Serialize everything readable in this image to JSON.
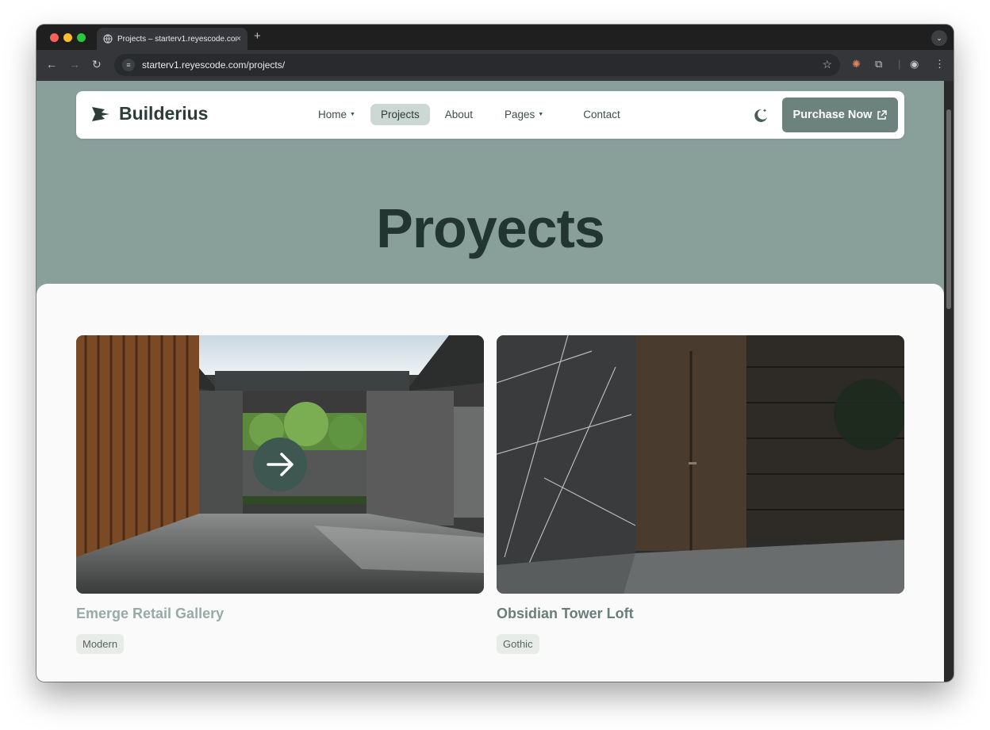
{
  "browser": {
    "tab_title": "Projects – starterv1.reyescode.com",
    "tab_close": "×",
    "new_tab": "+",
    "url": "starterv1.reyescode.com/projects/"
  },
  "site": {
    "brand": "Builderius",
    "nav": [
      {
        "label": "Home",
        "dropdown": true
      },
      {
        "label": "Projects",
        "active": true
      },
      {
        "label": "About"
      },
      {
        "label": "Pages",
        "dropdown": true
      },
      {
        "label": "Contact"
      }
    ],
    "theme_toggle_icon": "moon-stars-icon",
    "purchase_label": "Purchase Now",
    "purchase_icon": "external-link-icon"
  },
  "hero": {
    "title": "Proyects"
  },
  "projects": [
    {
      "title": "Emerge Retail Gallery",
      "tag": "Modern",
      "hover_icon": "arrow-right-icon"
    },
    {
      "title": "Obsidian Tower Loft",
      "tag": "Gothic"
    }
  ],
  "colors": {
    "hero_bg": "#899f9a",
    "accent": "#6b827d",
    "active_nav": "#cbd8d4",
    "title_dark": "#233531"
  }
}
